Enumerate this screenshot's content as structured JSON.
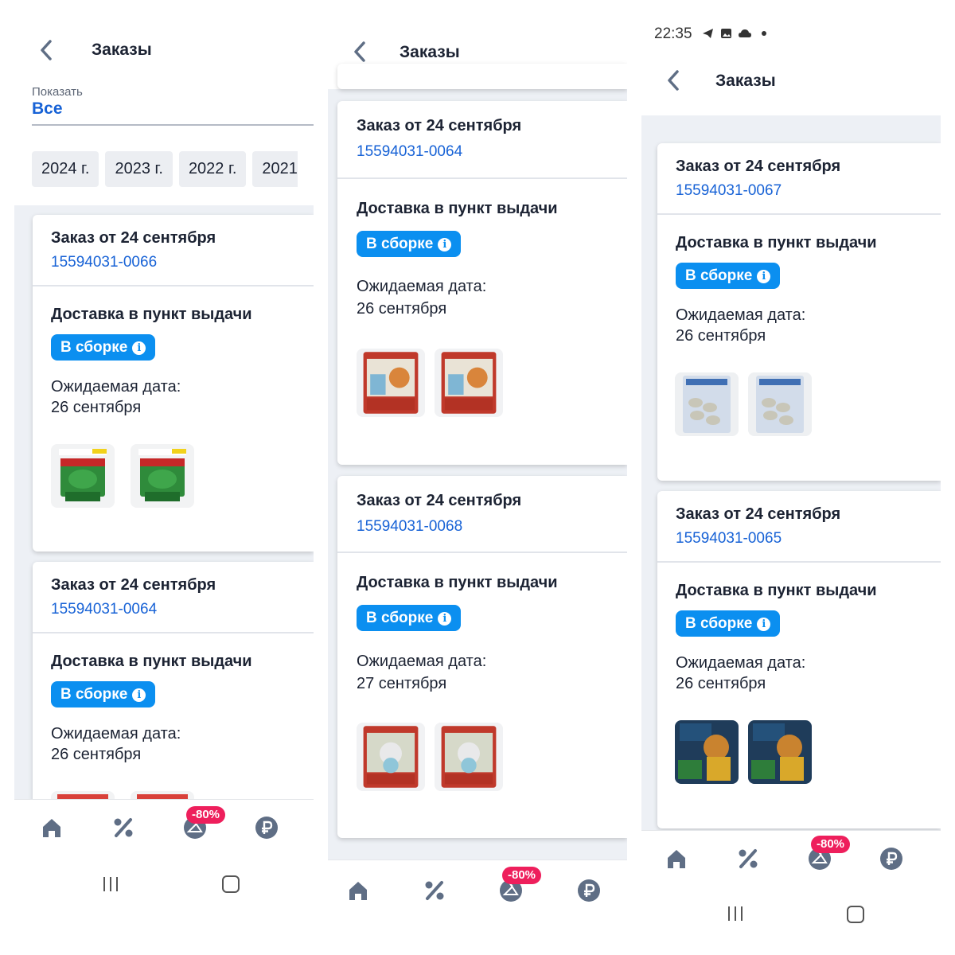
{
  "screens": [
    {
      "title": "Заказы",
      "filter": {
        "label": "Показать",
        "value": "Все"
      },
      "years": [
        "2024 г.",
        "2023 г.",
        "2022 г.",
        "2021"
      ],
      "orders": [
        {
          "title": "Заказ от 24 сентября",
          "number": "15594031-0066",
          "delivery": "Доставка в пункт выдачи",
          "status": "В сборке",
          "expected_label": "Ожидаемая дата:",
          "expected_date": "26 сентября"
        },
        {
          "title": "Заказ от 24 сентября",
          "number": "15594031-0064",
          "delivery": "Доставка в пункт выдачи",
          "status": "В сборке",
          "expected_label": "Ожидаемая дата:",
          "expected_date": "26 сентября"
        }
      ],
      "promo_badge": "-80%"
    },
    {
      "title": "Заказы",
      "orders": [
        {
          "title": "Заказ от 24 сентября",
          "number": "15594031-0064",
          "delivery": "Доставка в пункт выдачи",
          "status": "В сборке",
          "expected_label": "Ожидаемая дата:",
          "expected_date": "26 сентября"
        },
        {
          "title": "Заказ от 24 сентября",
          "number": "15594031-0068",
          "delivery": "Доставка в пункт выдачи",
          "status": "В сборке",
          "expected_label": "Ожидаемая дата:",
          "expected_date": "27 сентября"
        }
      ],
      "promo_badge": "-80%"
    },
    {
      "status_bar": {
        "time": "22:35"
      },
      "title": "Заказы",
      "orders": [
        {
          "title": "Заказ от 24 сентября",
          "number": "15594031-0067",
          "delivery": "Доставка в пункт выдачи",
          "status": "В сборке",
          "expected_label": "Ожидаемая дата:",
          "expected_date": "26 сентября"
        },
        {
          "title": "Заказ от 24 сентября",
          "number": "15594031-0065",
          "delivery": "Доставка в пункт выдачи",
          "status": "В сборке",
          "expected_label": "Ожидаемая дата:",
          "expected_date": "26 сентября"
        }
      ],
      "promo_badge": "-80%"
    }
  ],
  "colors": {
    "accent_blue": "#1762d6",
    "status_badge": "#0b8ff0",
    "promo_badge": "#ee1f5c",
    "nav_icon": "#5f6e85"
  },
  "nav_icons": [
    "home-icon",
    "percent-icon",
    "hanger-icon",
    "ruble-icon"
  ]
}
